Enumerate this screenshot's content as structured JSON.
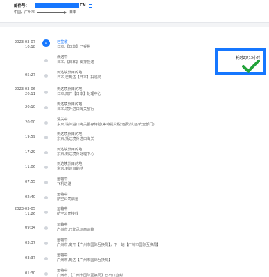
{
  "header": {
    "tracking_label": "邮件号：",
    "tracking_suffix": "CN",
    "origin": "中国，广州市",
    "destination": "日本"
  },
  "summary": {
    "elapsed": "耗时2天13小时"
  },
  "timeline": [
    {
      "date": "2023-03-07",
      "time": "10:18",
      "status": "已签收",
      "desc": "日本,【日本】已妥投",
      "active": true,
      "dot": "收"
    },
    {
      "date": "",
      "time": "",
      "status": "派送中",
      "desc": "日本,【日本】安排投递"
    },
    {
      "date": "",
      "time": "05:27",
      "status": "到达境外目的地",
      "desc": "日本,已到达【日本】投递局"
    },
    {
      "date": "2023-03-06",
      "time": "20:11",
      "status": "到达境外目的地",
      "desc": "日本,离开【日本】处理中心"
    },
    {
      "date": "",
      "time": "20:10",
      "status": "到达境外目的地",
      "desc": "日本,境外进口海关放行"
    },
    {
      "date": "",
      "time": "20:00",
      "status": "清关中",
      "desc": "东京,境外进口海关留存待验(等待提交税/运费/认证/安全部门)"
    },
    {
      "date": "",
      "time": "19:59",
      "status": "到达境外目的地",
      "desc": "东京,抵达境外进口海关"
    },
    {
      "date": "",
      "time": "17:29",
      "status": "到达境外目的地",
      "desc": "东京,到达境外处理中心"
    },
    {
      "date": "",
      "time": "11:06",
      "status": "到达境外目的地",
      "desc": "东京,到达目的地"
    },
    {
      "date": "",
      "time": "07:55",
      "status": "运输中",
      "desc": "飞机进港"
    },
    {
      "date": "",
      "time": "02:40",
      "status": "运输中",
      "desc": "航空公司启运"
    },
    {
      "date": "2023-03-05",
      "time": "11:26",
      "status": "运输中",
      "desc": "航空公司接收"
    },
    {
      "date": "",
      "time": "09:34",
      "status": "运输中",
      "desc": "广州市,已交承运商运输"
    },
    {
      "date": "",
      "time": "03:37",
      "status": "运输中",
      "desc": "广州市,离开【广州市国际互换局】，下一站【广州市国际互换局】"
    },
    {
      "date": "",
      "time": "03:37",
      "status": "运输中",
      "desc": "广州市,到达【广州市国际互换局】"
    },
    {
      "date": "",
      "time": "01:30",
      "status": "运输中",
      "desc": "广州市,【广州市国际互换局】已出口直封"
    }
  ]
}
